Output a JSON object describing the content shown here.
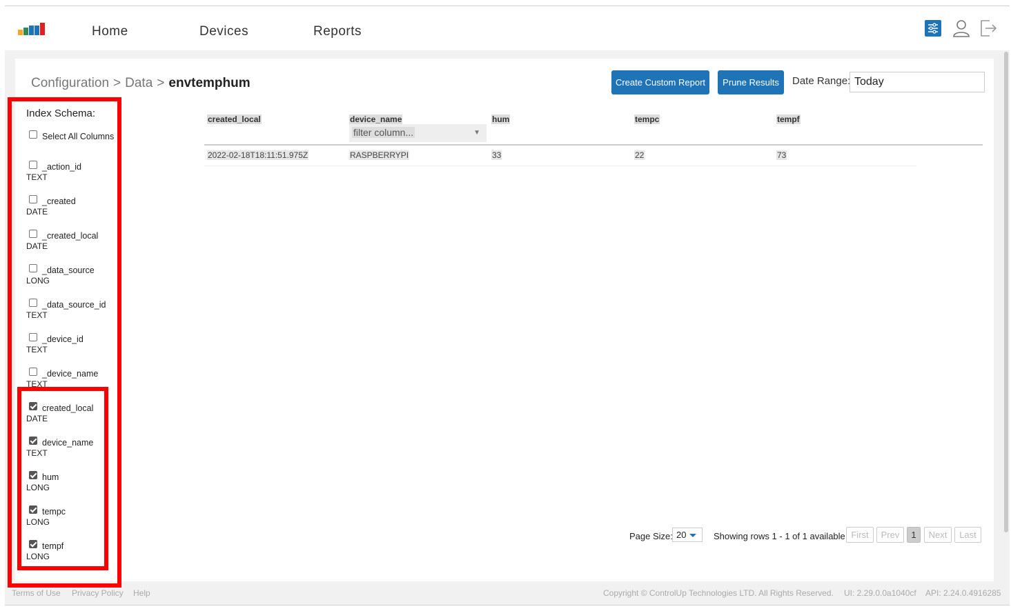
{
  "nav": {
    "items": [
      "Home",
      "Devices",
      "Reports"
    ],
    "logo_colors": [
      "#f5a623",
      "#2e8b57",
      "#1f73b7",
      "#e02020"
    ]
  },
  "breadcrumb": {
    "parts": [
      "Configuration",
      "Data"
    ],
    "separator": ">",
    "current": "envtemphum"
  },
  "actions": {
    "create_report": "Create Custom Report",
    "prune_results": "Prune Results",
    "date_range_label": "Date Range:",
    "date_range_value": "Today"
  },
  "schema": {
    "title": "Index Schema:",
    "select_all": "Select All Columns",
    "columns": [
      {
        "name": "_action_id",
        "type": "TEXT",
        "checked": false
      },
      {
        "name": "_created",
        "type": "DATE",
        "checked": false
      },
      {
        "name": "_created_local",
        "type": "DATE",
        "checked": false
      },
      {
        "name": "_data_source",
        "type": "LONG",
        "checked": false
      },
      {
        "name": "_data_source_id",
        "type": "TEXT",
        "checked": false
      },
      {
        "name": "_device_id",
        "type": "TEXT",
        "checked": false
      },
      {
        "name": "_device_name",
        "type": "TEXT",
        "checked": false
      },
      {
        "name": "created_local",
        "type": "DATE",
        "checked": true
      },
      {
        "name": "device_name",
        "type": "TEXT",
        "checked": true
      },
      {
        "name": "hum",
        "type": "LONG",
        "checked": true
      },
      {
        "name": "tempc",
        "type": "LONG",
        "checked": true
      },
      {
        "name": "tempf",
        "type": "LONG",
        "checked": true
      }
    ]
  },
  "table": {
    "headers": [
      "created_local",
      "device_name",
      "hum",
      "tempc",
      "tempf"
    ],
    "filter_placeholder": "filter column...",
    "rows": [
      [
        "2022-02-18T18:11:51.975Z",
        "RASPBERRYPI",
        "33",
        "22",
        "73"
      ]
    ]
  },
  "pager": {
    "page_size_label": "Page Size:",
    "page_size": "20",
    "showing": "Showing rows 1 - 1 of 1 available",
    "first": "First",
    "prev": "Prev",
    "current": "1",
    "next": "Next",
    "last": "Last"
  },
  "footer": {
    "terms": "Terms of Use",
    "privacy": "Privacy Policy",
    "help": "Help",
    "copyright": "Copyright © ControlUp Technologies LTD. All Rights Reserved.",
    "ui_version": "UI: 2.29.0.0a1040cf",
    "api_version": "API: 2.24.0.4916285"
  },
  "colors": {
    "accent": "#1f73b7",
    "annotation": "#ff0000"
  }
}
